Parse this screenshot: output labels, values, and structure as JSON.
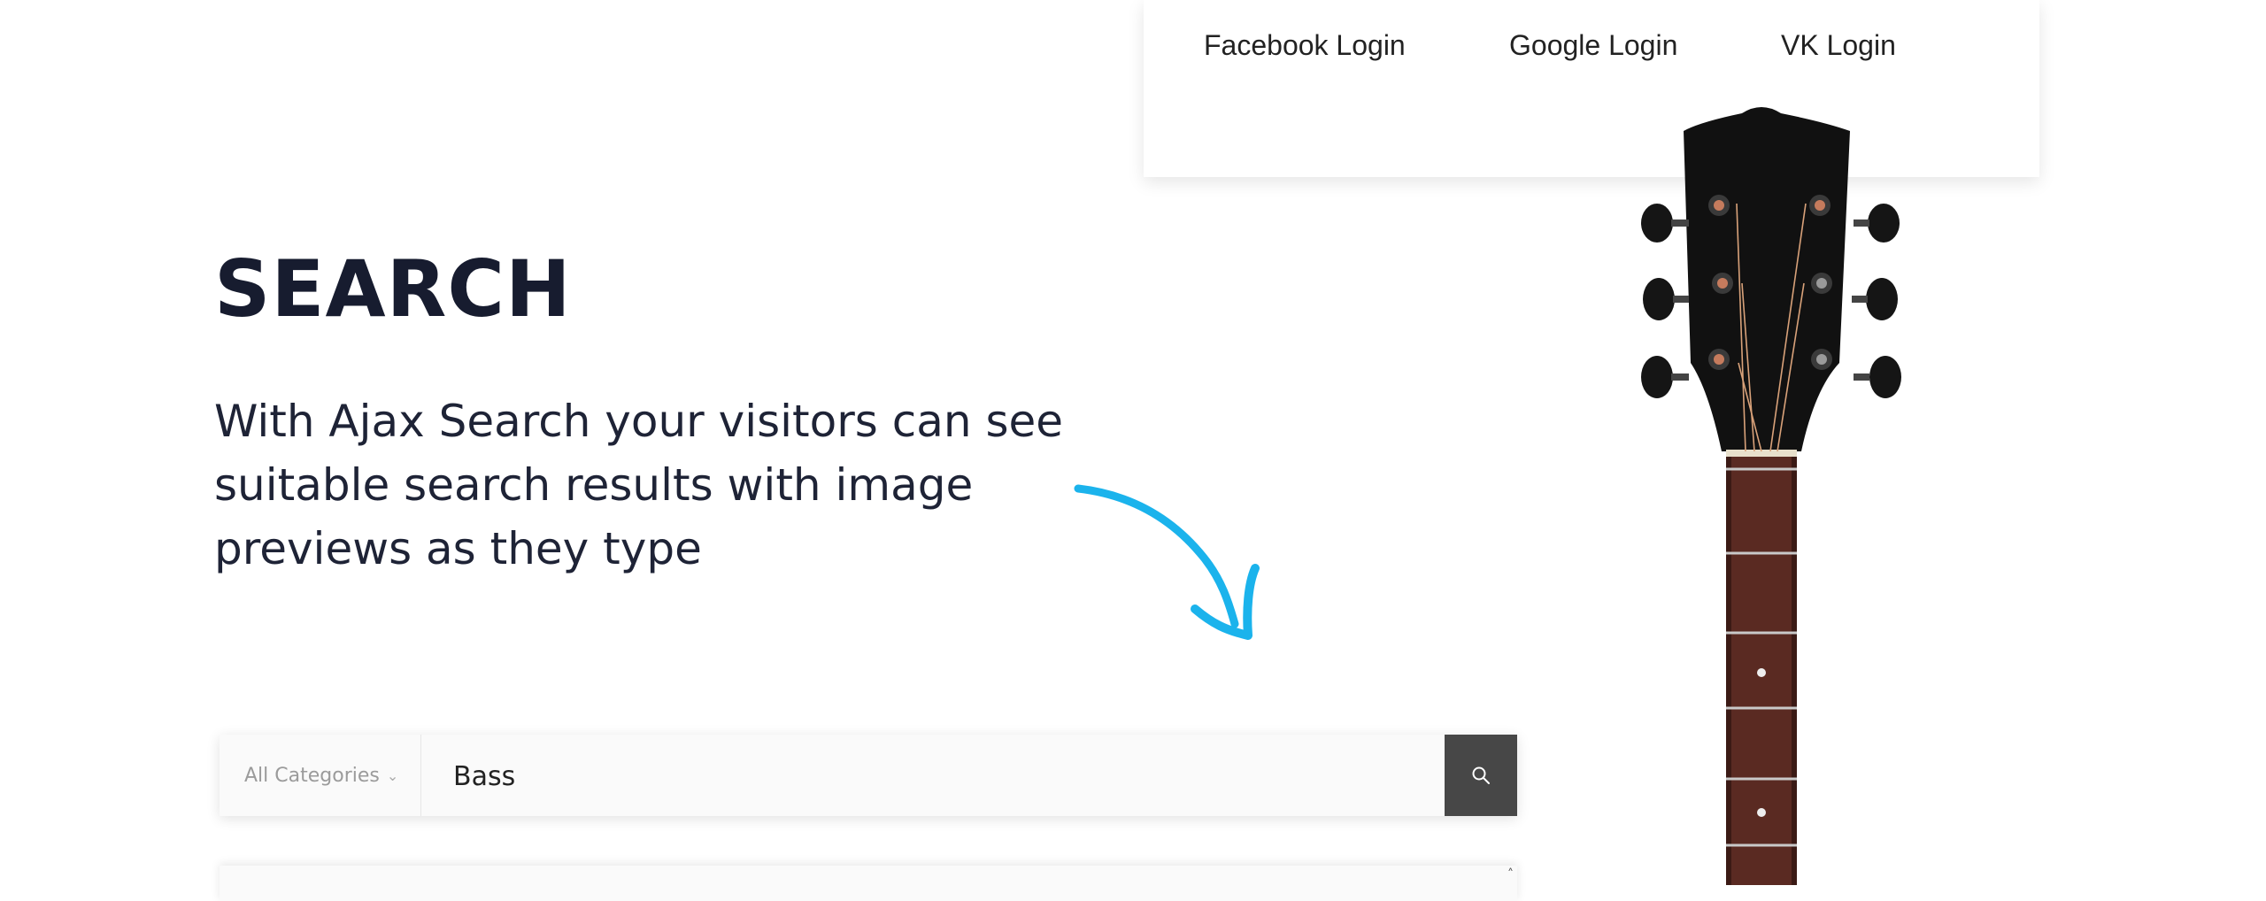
{
  "login": {
    "links": [
      "Facebook Login",
      "Google Login",
      "VK Login"
    ]
  },
  "hero": {
    "title": "SEARCH",
    "description": "With Ajax Search your visitors can see suitable search results with image previews as they type"
  },
  "search": {
    "category_label": "All Categories",
    "category_icon": "chevron-down-icon",
    "query": "Bass",
    "button_icon": "search-icon"
  },
  "colors": {
    "title": "#171c2f",
    "arrow": "#1bb3ec",
    "search_button": "#474747",
    "guitar_headstock": "#111111",
    "fretboard": "#5a2a22"
  }
}
